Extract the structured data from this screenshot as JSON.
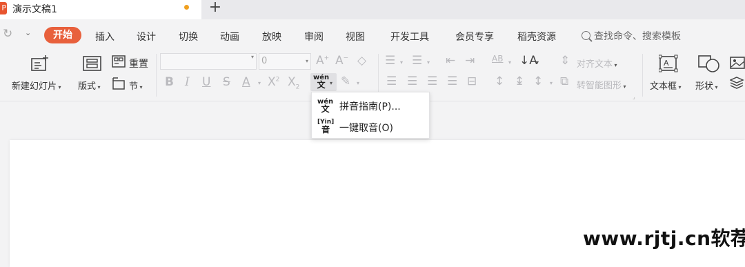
{
  "tab": {
    "app_icon_letter": "P",
    "title": "演示文稿1",
    "new_tab": "+"
  },
  "quick_access": {
    "redo": "↻",
    "dropdown": "⌄"
  },
  "menu": [
    "开始",
    "插入",
    "设计",
    "切换",
    "动画",
    "放映",
    "审阅",
    "视图",
    "开发工具",
    "会员专享",
    "稻壳资源"
  ],
  "search": {
    "placeholder": "查找命令、搜索模板"
  },
  "ribbon": {
    "new_slide": "新建幻灯片",
    "layout": "版式",
    "reset": "重置",
    "section": "节",
    "font_size": "0",
    "pinyin_icon_top": "wén",
    "pinyin_icon_bottom": "文",
    "align_text": "对齐文本",
    "smart_art": "转智能图形",
    "text_box": "文本框",
    "shape": "形状"
  },
  "dropdown": {
    "item1": {
      "icon_top": "wén",
      "icon_bottom": "文",
      "label": "拼音指南(P)..."
    },
    "item2": {
      "icon_top": "[Yin]",
      "icon_bottom": "音",
      "label": "一键取音(O)"
    }
  },
  "watermark": "www.rjtj.cn软荐网",
  "colors": {
    "accent": "#e8603c",
    "unsaved": "#f0a020"
  }
}
